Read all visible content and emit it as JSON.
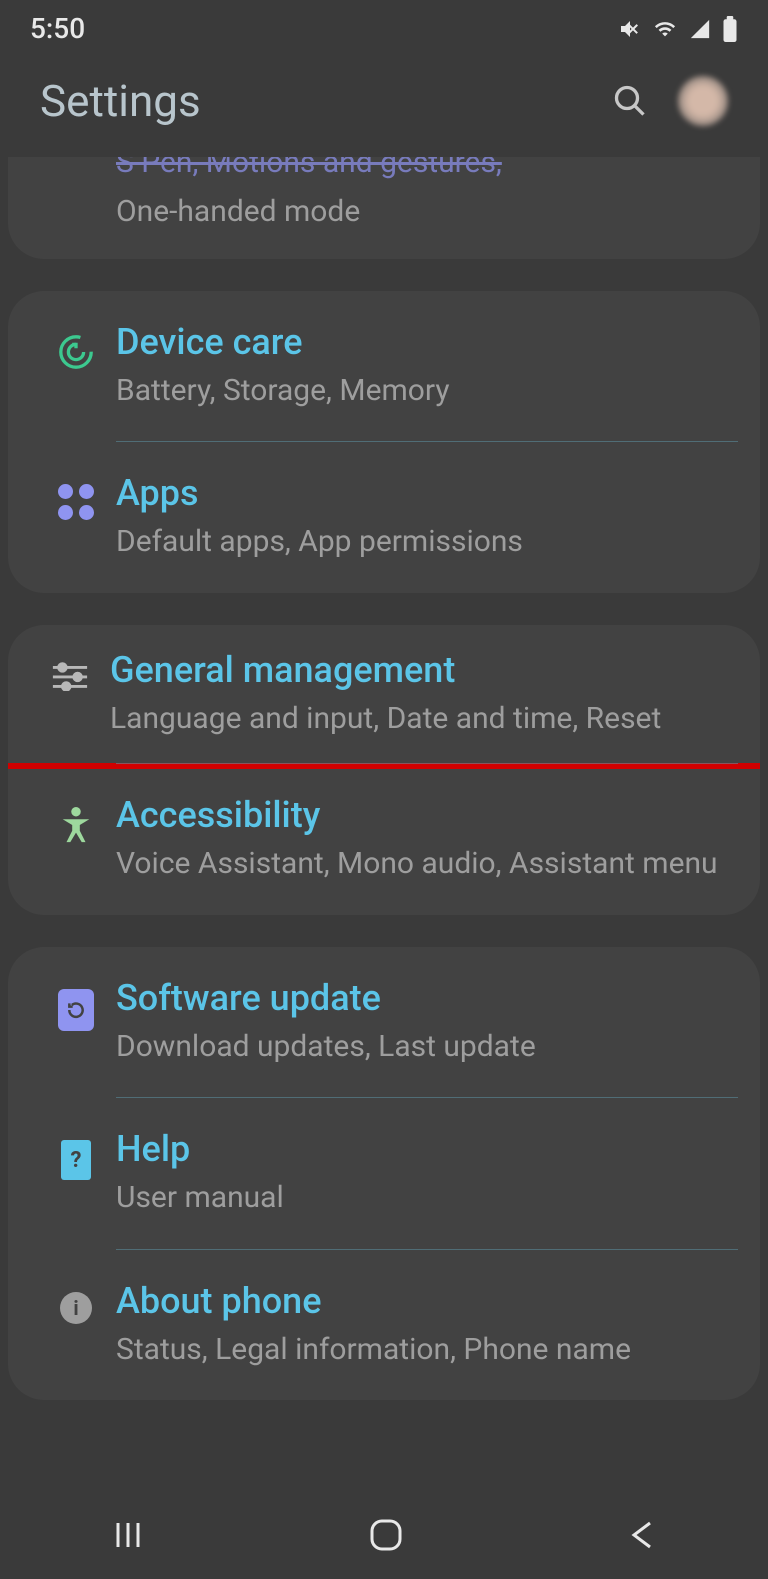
{
  "statusBar": {
    "time": "5:50"
  },
  "header": {
    "title": "Settings"
  },
  "partial": {
    "titleFragment": "S Pen, Motions and gestures,",
    "subtitle": "One-handed mode"
  },
  "groups": [
    {
      "items": [
        {
          "title": "Device care",
          "subtitle": "Battery, Storage, Memory"
        },
        {
          "title": "Apps",
          "subtitle": "Default apps, App permissions"
        }
      ]
    },
    {
      "items": [
        {
          "title": "General management",
          "subtitle": "Language and input, Date and time, Reset",
          "highlighted": true
        },
        {
          "title": "Accessibility",
          "subtitle": "Voice Assistant, Mono audio, Assistant menu"
        }
      ]
    },
    {
      "items": [
        {
          "title": "Software update",
          "subtitle": "Download updates, Last update"
        },
        {
          "title": "Help",
          "subtitle": "User manual"
        },
        {
          "title": "About phone",
          "subtitle": "Status, Legal information, Phone name"
        }
      ]
    }
  ]
}
